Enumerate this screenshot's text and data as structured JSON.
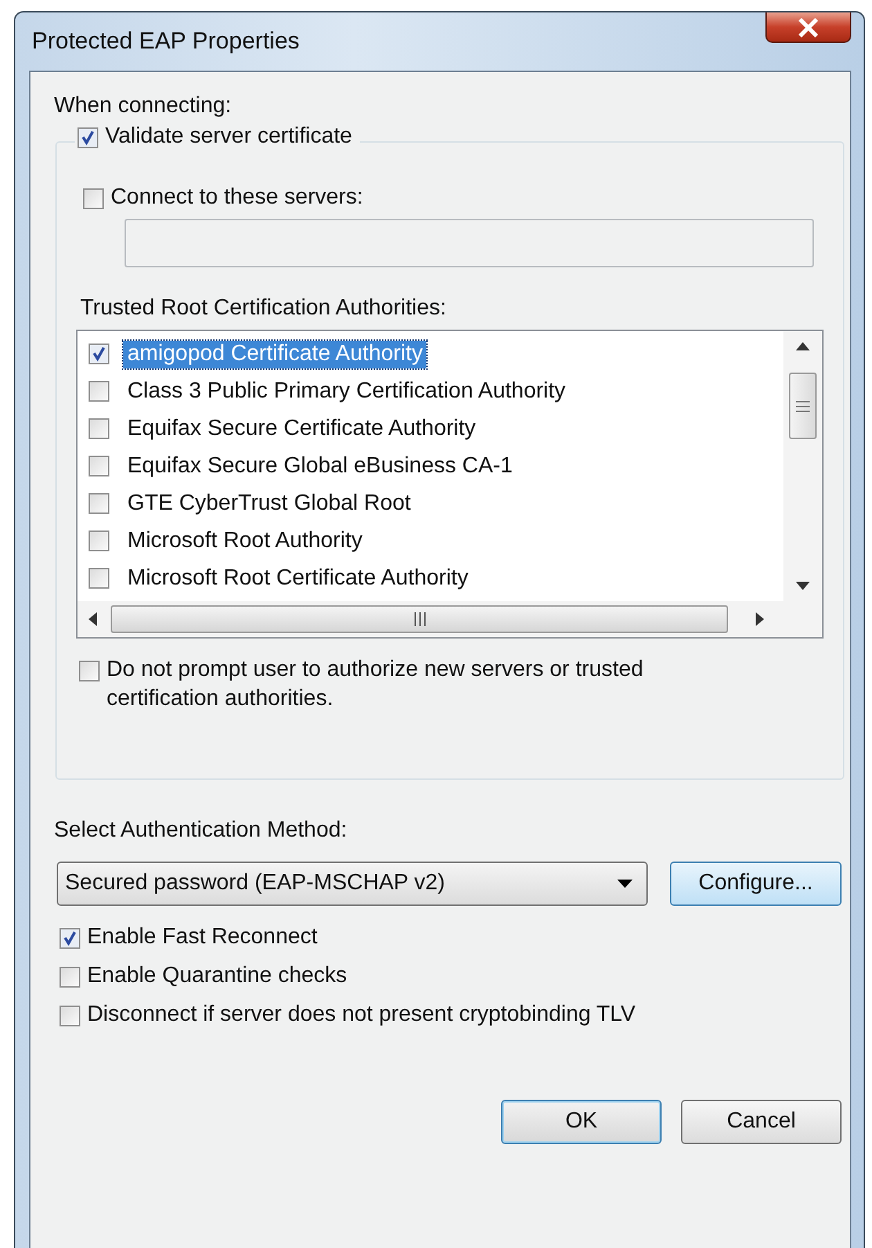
{
  "window": {
    "title": "Protected EAP Properties"
  },
  "when_connecting_label": "When connecting:",
  "validate_group": {
    "label": "Validate server certificate",
    "checked": true,
    "connect_servers": {
      "label": "Connect to these servers:",
      "checked": false
    },
    "trusted_roots": {
      "label": "Trusted Root Certification Authorities:",
      "items": [
        {
          "label": "amigopod Certificate Authority",
          "checked": true,
          "selected": true
        },
        {
          "label": "Class 3 Public Primary Certification Authority",
          "checked": false,
          "selected": false
        },
        {
          "label": "Equifax Secure Certificate Authority",
          "checked": false,
          "selected": false
        },
        {
          "label": "Equifax Secure Global eBusiness CA-1",
          "checked": false,
          "selected": false
        },
        {
          "label": "GTE CyberTrust Global Root",
          "checked": false,
          "selected": false
        },
        {
          "label": "Microsoft Root Authority",
          "checked": false,
          "selected": false
        },
        {
          "label": "Microsoft Root Certificate Authority",
          "checked": false,
          "selected": false
        }
      ]
    },
    "no_prompt": {
      "label": "Do not prompt user to authorize new servers or trusted certification authorities.",
      "checked": false
    }
  },
  "auth": {
    "label": "Select Authentication Method:",
    "value": "Secured password (EAP-MSCHAP v2)",
    "configure_button": {
      "label": "Configure...",
      "highlighted": true
    }
  },
  "options": [
    {
      "label": "Enable Fast Reconnect",
      "checked": true
    },
    {
      "label": "Enable Quarantine checks",
      "checked": false
    },
    {
      "label": "Disconnect if server does not present cryptobinding TLV",
      "checked": false
    }
  ],
  "buttons": [
    {
      "label": "OK",
      "highlighted": true
    },
    {
      "label": "Cancel",
      "highlighted": false
    }
  ]
}
